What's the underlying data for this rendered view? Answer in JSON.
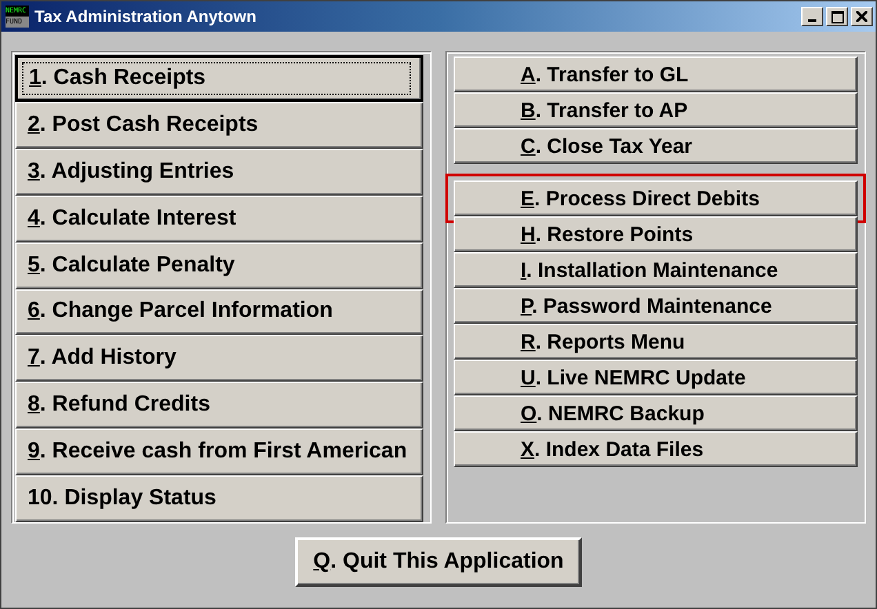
{
  "window": {
    "title": "Tax Administration Anytown",
    "logo_top": "NEMRC",
    "logo_bottom": "FUND"
  },
  "left_menu": [
    {
      "hotkey": "1",
      "label": ". Cash Receipts",
      "focused": true
    },
    {
      "hotkey": "2",
      "label": ". Post Cash Receipts",
      "focused": false
    },
    {
      "hotkey": "3",
      "label": ". Adjusting Entries",
      "focused": false
    },
    {
      "hotkey": "4",
      "label": ". Calculate Interest",
      "focused": false
    },
    {
      "hotkey": "5",
      "label": ". Calculate Penalty",
      "focused": false
    },
    {
      "hotkey": "6",
      "label": ". Change Parcel Information",
      "focused": false
    },
    {
      "hotkey": "7",
      "label": ". Add History",
      "focused": false
    },
    {
      "hotkey": "8",
      "label": ". Refund Credits",
      "focused": false
    },
    {
      "hotkey": "9",
      "label": ".  Receive cash from First American",
      "focused": false
    },
    {
      "label": "10. Display Status",
      "focused": false
    }
  ],
  "right_menu_top": [
    {
      "hotkey": "A",
      "label": ". Transfer to GL",
      "highlighted": false
    },
    {
      "hotkey": "B",
      "label": ". Transfer to AP",
      "highlighted": false
    },
    {
      "hotkey": "C",
      "label": ". Close Tax Year",
      "highlighted": false
    }
  ],
  "right_menu_bottom": [
    {
      "hotkey": "E",
      "label": ". Process Direct Debits",
      "highlighted": true
    },
    {
      "hotkey": "H",
      "label": ". Restore Points",
      "highlighted": false
    },
    {
      "hotkey": "I",
      "label": ". Installation Maintenance",
      "highlighted": false
    },
    {
      "hotkey": "P",
      "label": ". Password Maintenance",
      "highlighted": false
    },
    {
      "hotkey": "R",
      "label": ". Reports Menu",
      "highlighted": false
    },
    {
      "hotkey": "U",
      "label": ". Live NEMRC Update",
      "highlighted": false
    },
    {
      "hotkey": "O",
      "label": ". NEMRC Backup",
      "highlighted": false
    },
    {
      "hotkey": "X",
      "label": ". Index Data Files",
      "highlighted": false
    }
  ],
  "quit_button": {
    "hotkey": "Q",
    "label": ".  Quit This Application"
  }
}
